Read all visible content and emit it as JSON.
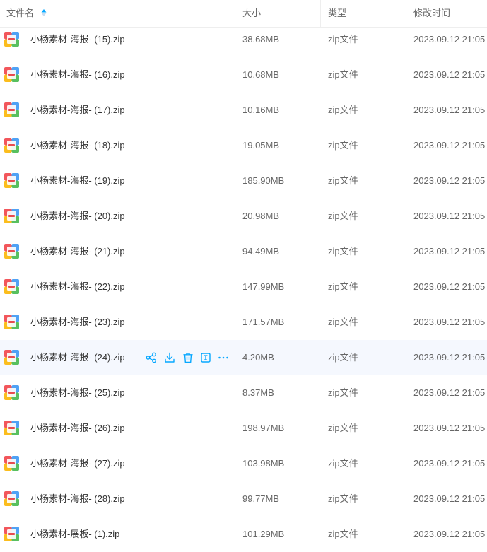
{
  "header": {
    "name_label": "文件名",
    "size_label": "大小",
    "type_label": "类型",
    "time_label": "修改时间"
  },
  "colors": {
    "accent": "#06a7ff",
    "hover_row": "#f5f8fe"
  },
  "icons": {
    "file": "zip-archive-icon",
    "sort": "sort-ascending-icon",
    "share": "share-icon",
    "download": "download-icon",
    "delete": "delete-icon",
    "rename": "rename-icon",
    "more": "more-icon"
  },
  "hover_row_index": 9,
  "files": [
    {
      "name": "小杨素材-海报- (15).zip",
      "size": "38.68MB",
      "type": "zip文件",
      "modified": "2023.09.12 21:05"
    },
    {
      "name": "小杨素材-海报- (16).zip",
      "size": "10.68MB",
      "type": "zip文件",
      "modified": "2023.09.12 21:05"
    },
    {
      "name": "小杨素材-海报- (17).zip",
      "size": "10.16MB",
      "type": "zip文件",
      "modified": "2023.09.12 21:05"
    },
    {
      "name": "小杨素材-海报- (18).zip",
      "size": "19.05MB",
      "type": "zip文件",
      "modified": "2023.09.12 21:05"
    },
    {
      "name": "小杨素材-海报- (19).zip",
      "size": "185.90MB",
      "type": "zip文件",
      "modified": "2023.09.12 21:05"
    },
    {
      "name": "小杨素材-海报- (20).zip",
      "size": "20.98MB",
      "type": "zip文件",
      "modified": "2023.09.12 21:05"
    },
    {
      "name": "小杨素材-海报- (21).zip",
      "size": "94.49MB",
      "type": "zip文件",
      "modified": "2023.09.12 21:05"
    },
    {
      "name": "小杨素材-海报- (22).zip",
      "size": "147.99MB",
      "type": "zip文件",
      "modified": "2023.09.12 21:05"
    },
    {
      "name": "小杨素材-海报- (23).zip",
      "size": "171.57MB",
      "type": "zip文件",
      "modified": "2023.09.12 21:05"
    },
    {
      "name": "小杨素材-海报- (24).zip",
      "size": "4.20MB",
      "type": "zip文件",
      "modified": "2023.09.12 21:05"
    },
    {
      "name": "小杨素材-海报- (25).zip",
      "size": "8.37MB",
      "type": "zip文件",
      "modified": "2023.09.12 21:05"
    },
    {
      "name": "小杨素材-海报- (26).zip",
      "size": "198.97MB",
      "type": "zip文件",
      "modified": "2023.09.12 21:05"
    },
    {
      "name": "小杨素材-海报- (27).zip",
      "size": "103.98MB",
      "type": "zip文件",
      "modified": "2023.09.12 21:05"
    },
    {
      "name": "小杨素材-海报- (28).zip",
      "size": "99.77MB",
      "type": "zip文件",
      "modified": "2023.09.12 21:05"
    },
    {
      "name": "小杨素材-展板- (1).zip",
      "size": "101.29MB",
      "type": "zip文件",
      "modified": "2023.09.12 21:05"
    }
  ]
}
